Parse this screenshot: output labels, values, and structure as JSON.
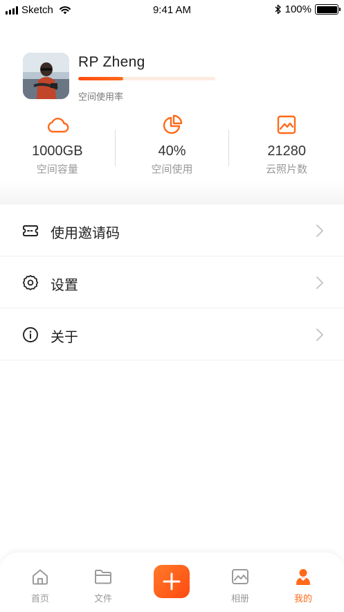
{
  "status_bar": {
    "carrier": "Sketch",
    "time": "9:41 AM",
    "battery": "100%"
  },
  "profile": {
    "name": "RP Zheng",
    "usage_label": "空间使用率",
    "usage_fraction": 0.33
  },
  "stats": [
    {
      "value": "1000GB",
      "label": "空间容量",
      "icon": "cloud-icon"
    },
    {
      "value": "40%",
      "label": "空间使用",
      "icon": "pie-chart-icon"
    },
    {
      "value": "21280",
      "label": "云照片数",
      "icon": "image-icon"
    }
  ],
  "menu": [
    {
      "label": "使用邀请码",
      "icon": "ticket-icon"
    },
    {
      "label": "设置",
      "icon": "gear-icon"
    },
    {
      "label": "关于",
      "icon": "info-icon"
    }
  ],
  "tabbar": {
    "tabs": [
      {
        "label": "首页",
        "icon": "home-icon",
        "active": false
      },
      {
        "label": "文件",
        "icon": "folder-icon",
        "active": false
      },
      {
        "label": "相册",
        "icon": "album-icon",
        "active": false
      },
      {
        "label": "我的",
        "icon": "user-icon",
        "active": true
      }
    ],
    "add_icon": "plus-icon"
  },
  "colors": {
    "accent": "#ff6a1a",
    "text": "#222222",
    "muted": "#999999"
  }
}
